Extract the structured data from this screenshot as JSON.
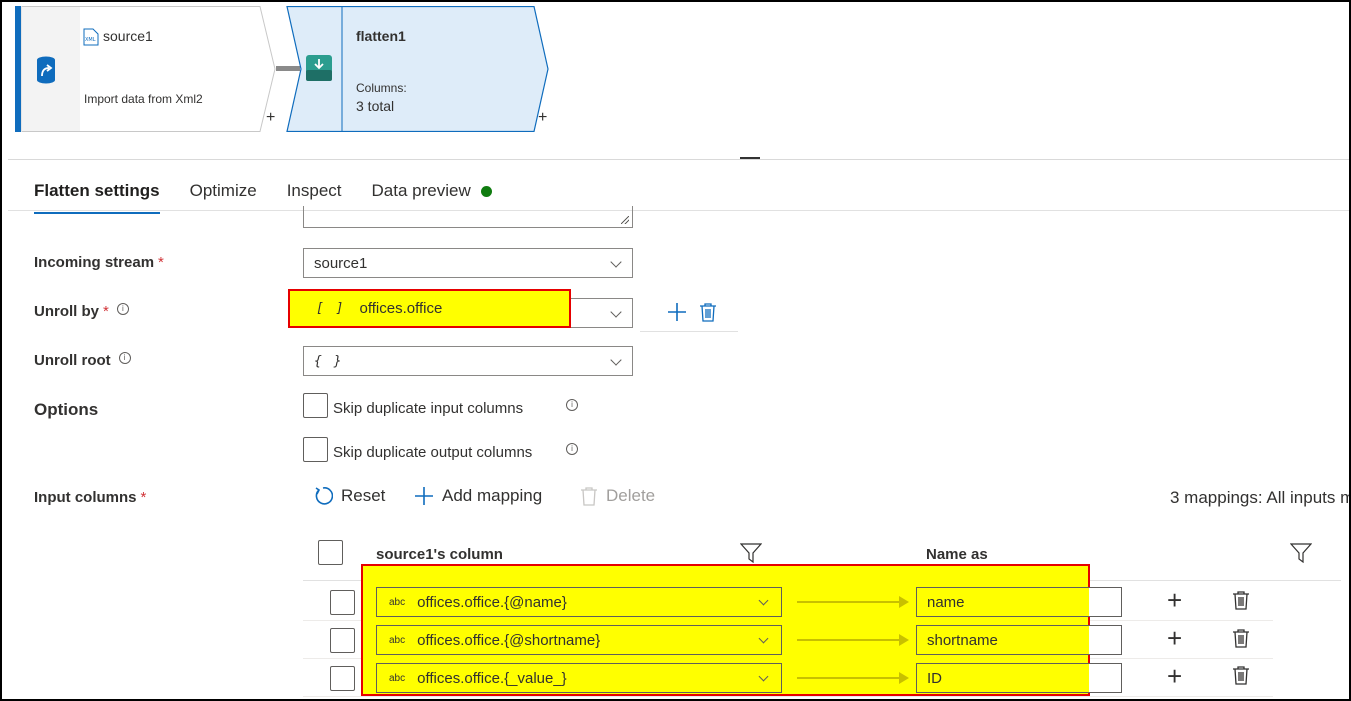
{
  "pipeline": {
    "source": {
      "title": "source1",
      "subtitle": "Import data from Xml2",
      "add": "+"
    },
    "flatten": {
      "title": "flatten1",
      "columns_label": "Columns:",
      "columns_value": "3 total",
      "add": "+"
    }
  },
  "tabs": [
    {
      "label": "Flatten settings",
      "active": true
    },
    {
      "label": "Optimize"
    },
    {
      "label": "Inspect"
    },
    {
      "label": "Data preview",
      "status_color": "#107c10"
    }
  ],
  "form": {
    "incoming_stream": {
      "label": "Incoming stream",
      "required": "*",
      "value": "source1"
    },
    "unroll_by": {
      "label": "Unroll by",
      "required": "*",
      "icon": "[ ]",
      "value": "offices.office"
    },
    "unroll_root": {
      "label": "Unroll root",
      "value": "{ }"
    },
    "options": {
      "label": "Options",
      "skip_input": "Skip duplicate input columns",
      "skip_output": "Skip duplicate output columns"
    },
    "input_columns": {
      "label": "Input columns",
      "required": "*"
    }
  },
  "toolbar": {
    "reset": "Reset",
    "add_mapping": "Add mapping",
    "delete": "Delete",
    "summary": "3 mappings: All inputs m"
  },
  "table": {
    "source_header": "source1's column",
    "name_header": "Name as",
    "rows": [
      {
        "type": "abc",
        "source": "offices.office.{@name}",
        "name": "name"
      },
      {
        "type": "abc",
        "source": "offices.office.{@shortname}",
        "name": "shortname"
      },
      {
        "type": "abc",
        "source": "offices.office.{_value_}",
        "name": "ID"
      }
    ]
  },
  "colors": {
    "accent": "#0f6cbd",
    "highlight": "#ffff00",
    "highlight_border": "#e60000",
    "success": "#107c10"
  }
}
